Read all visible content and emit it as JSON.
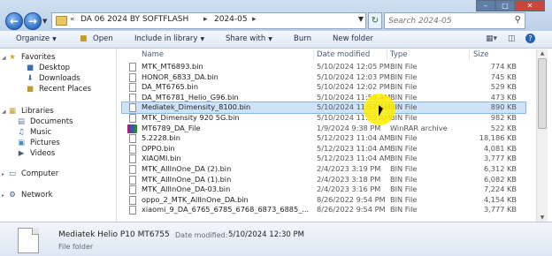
{
  "address": {
    "crumbs": [
      "DA 06 2024 BY SOFTFLASH",
      "2024-05"
    ],
    "search_placeholder": "Search 2024-05"
  },
  "toolbar": {
    "organize": "Organize",
    "open": "Open",
    "include": "Include in library",
    "share": "Share with",
    "burn": "Burn",
    "new_folder": "New folder"
  },
  "sidebar": {
    "favorites": "Favorites",
    "fav_items": [
      "Desktop",
      "Downloads",
      "Recent Places"
    ],
    "libraries": "Libraries",
    "lib_items": [
      "Documents",
      "Music",
      "Pictures",
      "Videos"
    ],
    "computer": "Computer",
    "network": "Network"
  },
  "columns": {
    "name": "Name",
    "date": "Date modified",
    "type": "Type",
    "size": "Size"
  },
  "files": [
    {
      "name": "MTK_MT6893.bin",
      "date": "5/10/2024 12:05 PM",
      "type": "BIN File",
      "size": "774 KB"
    },
    {
      "name": "HONOR_6833_DA.bin",
      "date": "5/10/2024 12:03 PM",
      "type": "BIN File",
      "size": "745 KB"
    },
    {
      "name": "DA_MT6765.bin",
      "date": "5/10/2024 12:02 PM",
      "type": "BIN File",
      "size": "529 KB"
    },
    {
      "name": "DA_MT6781_Helio_G96.bin",
      "date": "5/10/2024 11:59 AM",
      "type": "BIN File",
      "size": "473 KB"
    },
    {
      "name": "Mediatek_Dimensity_8100.bin",
      "date": "5/10/2024 11:57 AM",
      "type": "BIN File",
      "size": "890 KB"
    },
    {
      "name": "MTK_Dimensity 920 5G.bin",
      "date": "5/10/2024 11:55 AM",
      "type": "BIN File",
      "size": "982 KB"
    },
    {
      "name": "MT6789_DA_File",
      "date": "1/9/2024 9:38 PM",
      "type": "WinRAR archive",
      "size": "522 KB"
    },
    {
      "name": "5.2228.bin",
      "date": "5/12/2023 11:04 AM",
      "type": "BIN File",
      "size": "18,186 KB"
    },
    {
      "name": "OPPO.bin",
      "date": "5/12/2023 11:04 AM",
      "type": "BIN File",
      "size": "4,081 KB"
    },
    {
      "name": "XIAOMI.bin",
      "date": "5/12/2023 11:04 AM",
      "type": "BIN File",
      "size": "3,777 KB"
    },
    {
      "name": "MTK_AllInOne_DA (2).bin",
      "date": "2/4/2023 3:19 PM",
      "type": "BIN File",
      "size": "6,312 KB"
    },
    {
      "name": "MTK_AllInOne_DA (1).bin",
      "date": "2/4/2023 3:18 PM",
      "type": "BIN File",
      "size": "6,082 KB"
    },
    {
      "name": "MTK_AllInOne_DA-03.bin",
      "date": "2/4/2023 3:16 PM",
      "type": "BIN File",
      "size": "7,224 KB"
    },
    {
      "name": "oppo_2_MTK_AllInOne_DA.bin",
      "date": "8/26/2022 9:54 PM",
      "type": "BIN File",
      "size": "4,154 KB"
    },
    {
      "name": "xiaomi_9_DA_6765_6785_6768_6873_6885_...",
      "date": "8/26/2022 9:54 PM",
      "type": "BIN File",
      "size": "3,777 KB"
    }
  ],
  "selected_index": 4,
  "details": {
    "name": "Mediatek Helio P10 MT6755",
    "date_label": "Date modified:",
    "date_value": "5/10/2024 12:30 PM",
    "type": "File folder"
  }
}
